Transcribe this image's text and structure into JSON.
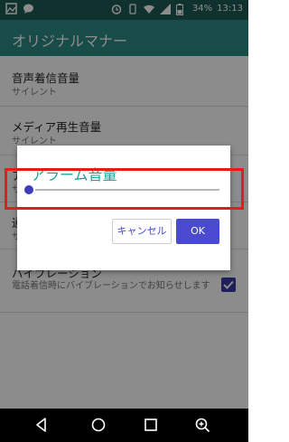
{
  "status_bar": {
    "battery_percent": "34%",
    "time": "13:13"
  },
  "app_bar": {
    "title": "オリジナルマナー"
  },
  "settings": [
    {
      "title": "音声着信音量",
      "subtitle": "サイレント"
    },
    {
      "title": "メディア再生音量",
      "subtitle": "サイレント"
    },
    {
      "title": "ア",
      "subtitle": "サ"
    },
    {
      "title": "通",
      "subtitle": "サ"
    },
    {
      "title": "バイブレーション",
      "subtitle": "電話着信時にバイブレーションでお知らせします",
      "checked": true
    }
  ],
  "dialog": {
    "title": "アラーム音量",
    "slider_value": 0,
    "cancel_label": "キャンセル",
    "ok_label": "OK"
  },
  "colors": {
    "app_bar": "#2b8a83",
    "status_bar": "#1e5b57",
    "accent": "#4a4ad0",
    "dialog_title": "#1aa59a",
    "highlight": "#e31d1d"
  },
  "icons": {
    "nav": [
      "back-icon",
      "home-icon",
      "recents-icon",
      "zoom-icon"
    ]
  }
}
